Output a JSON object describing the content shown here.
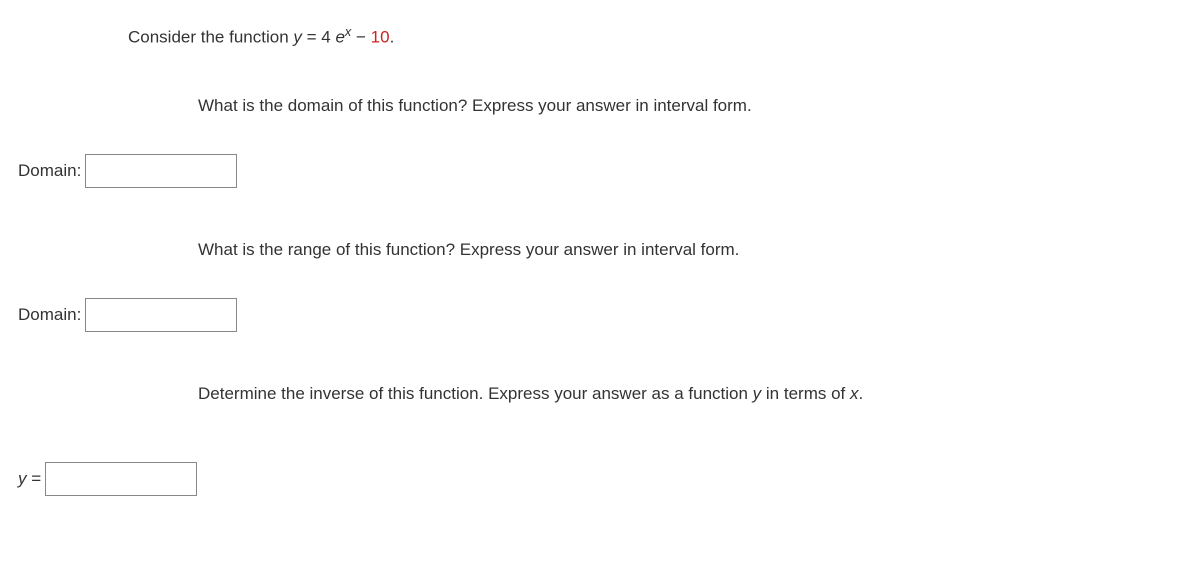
{
  "intro": {
    "prefix": "Consider the function ",
    "var_y": "y",
    "equals": " = 4 ",
    "e": "e",
    "sup": "x",
    "minus": " − ",
    "ten": "10",
    "period": "."
  },
  "q1": {
    "text": "What is the domain of this function? Express your answer in interval form.",
    "label": "Domain:"
  },
  "q2": {
    "text": "What is the range of this function? Express your answer in interval form.",
    "label": "Domain:"
  },
  "q3": {
    "prefix": "Determine the inverse of this function. Express your answer as a function ",
    "var_y": "y",
    "mid": " in terms of ",
    "var_x": "x",
    "suffix": ".",
    "label_var": "y",
    "label_eq": " ="
  }
}
